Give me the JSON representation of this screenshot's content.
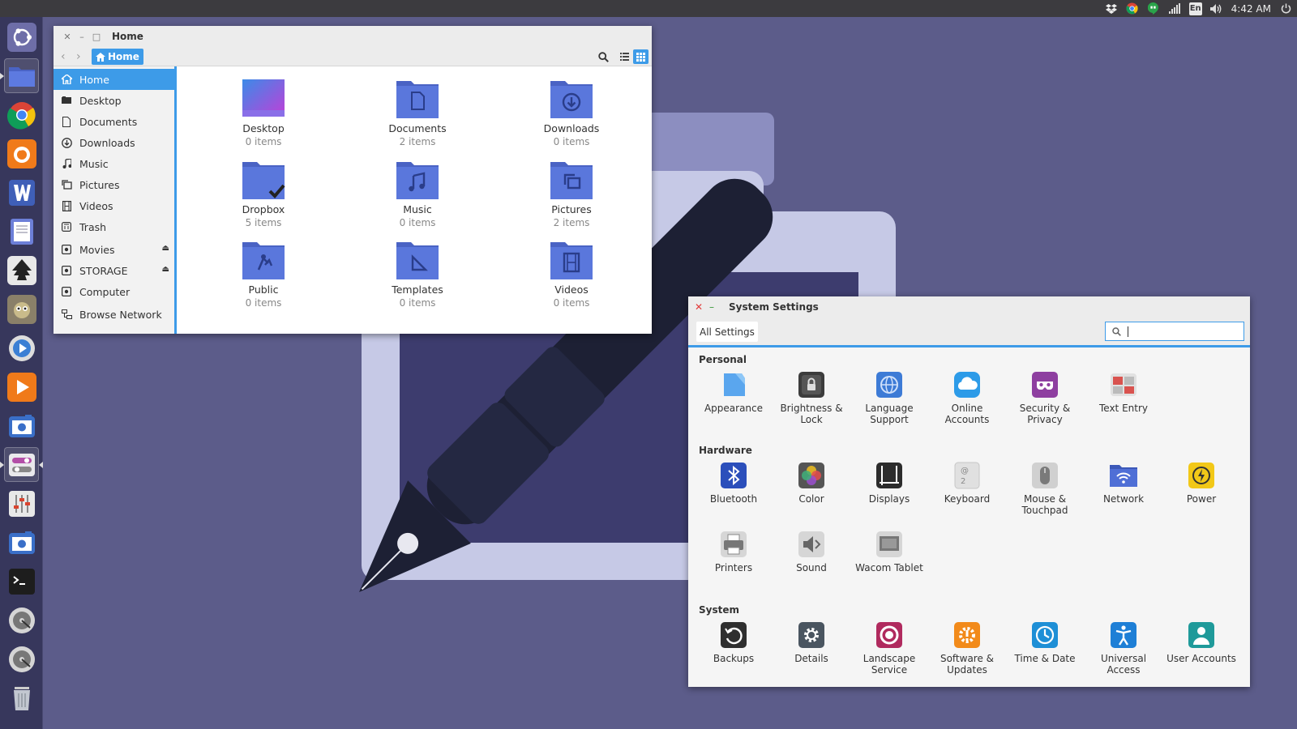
{
  "top_panel": {
    "time": "4:42 AM",
    "language": "En",
    "icons": [
      "dropbox-icon",
      "chrome-icon",
      "hangouts-icon",
      "signal-icon",
      "keyboard-language-icon",
      "volume-icon",
      "power-icon"
    ]
  },
  "launcher": {
    "items": [
      "dash-home-icon",
      "files-icon",
      "chrome-icon",
      "firefox-icon",
      "writer-icon",
      "text-editor-icon",
      "inkscape-icon",
      "gimp-icon",
      "video-player-icon",
      "media-player-icon",
      "camera-icon",
      "system-settings-icon",
      "mixer-icon",
      "screenshot-icon",
      "terminal-icon",
      "disk-icon",
      "disk-icon-2",
      "trash-icon"
    ]
  },
  "files": {
    "title": "Home",
    "breadcrumb": "Home",
    "sidebar": [
      {
        "label": "Home",
        "icon": "home-icon"
      },
      {
        "label": "Desktop",
        "icon": "desktop-icon"
      },
      {
        "label": "Documents",
        "icon": "document-icon"
      },
      {
        "label": "Downloads",
        "icon": "download-icon"
      },
      {
        "label": "Music",
        "icon": "music-icon"
      },
      {
        "label": "Pictures",
        "icon": "pictures-icon"
      },
      {
        "label": "Videos",
        "icon": "videos-icon"
      },
      {
        "label": "Trash",
        "icon": "trash-icon"
      },
      {
        "label": "Movies",
        "icon": "drive-icon"
      },
      {
        "label": "STORAGE",
        "icon": "drive-icon"
      },
      {
        "label": "Computer",
        "icon": "drive-icon"
      },
      {
        "label": "Browse Network",
        "icon": "network-icon"
      }
    ],
    "folders": [
      {
        "name": "Desktop",
        "count": "0 items"
      },
      {
        "name": "Documents",
        "count": "2 items"
      },
      {
        "name": "Downloads",
        "count": "0 items"
      },
      {
        "name": "Dropbox",
        "count": "5 items"
      },
      {
        "name": "Music",
        "count": "0 items"
      },
      {
        "name": "Pictures",
        "count": "2 items"
      },
      {
        "name": "Public",
        "count": "0 items"
      },
      {
        "name": "Templates",
        "count": "0 items"
      },
      {
        "name": "Videos",
        "count": "0 items"
      }
    ]
  },
  "settings": {
    "title": "System Settings",
    "all_settings": "All Settings",
    "search_value": "",
    "categories": {
      "personal": "Personal",
      "hardware": "Hardware",
      "system": "System"
    },
    "personal": [
      {
        "l1": "Appearance",
        "l2": "",
        "icon": "appearance-icon",
        "color": "#4a90d9"
      },
      {
        "l1": "Brightness &",
        "l2": "Lock",
        "icon": "lock-icon",
        "color": "#3c3c3c"
      },
      {
        "l1": "Language",
        "l2": "Support",
        "icon": "language-icon",
        "color": "#3d7bd6"
      },
      {
        "l1": "Online",
        "l2": "Accounts",
        "icon": "cloud-icon",
        "color": "#2d9be8"
      },
      {
        "l1": "Security &",
        "l2": "Privacy",
        "icon": "mask-icon",
        "color": "#8e3fa0"
      },
      {
        "l1": "Text Entry",
        "l2": "",
        "icon": "text-entry-icon",
        "color": "#d9d9d9"
      }
    ],
    "hardware": [
      {
        "l1": "Bluetooth",
        "l2": "",
        "icon": "bluetooth-icon",
        "color": "#2b4fbb"
      },
      {
        "l1": "Color",
        "l2": "",
        "icon": "color-icon",
        "color": "#555"
      },
      {
        "l1": "Displays",
        "l2": "",
        "icon": "displays-icon",
        "color": "#2c2c2c"
      },
      {
        "l1": "Keyboard",
        "l2": "",
        "icon": "keyboard-icon",
        "color": "#e0e0e0"
      },
      {
        "l1": "Mouse &",
        "l2": "Touchpad",
        "icon": "mouse-icon",
        "color": "#d0d0d0"
      },
      {
        "l1": "Network",
        "l2": "",
        "icon": "network-folder-icon",
        "color": "#3d6ed1"
      },
      {
        "l1": "Power",
        "l2": "",
        "icon": "power-icon",
        "color": "#f2c818"
      },
      {
        "l1": "Printers",
        "l2": "",
        "icon": "printer-icon",
        "color": "#d6d6d6"
      },
      {
        "l1": "Sound",
        "l2": "",
        "icon": "sound-icon",
        "color": "#d6d6d6"
      },
      {
        "l1": "Wacom Tablet",
        "l2": "",
        "icon": "tablet-icon",
        "color": "#d6d6d6"
      }
    ],
    "system": [
      {
        "l1": "Backups",
        "l2": "",
        "icon": "backup-icon",
        "color": "#2f2f2f"
      },
      {
        "l1": "Details",
        "l2": "",
        "icon": "gear-icon",
        "color": "#4a5560"
      },
      {
        "l1": "Landscape",
        "l2": "Service",
        "icon": "landscape-icon",
        "color": "#b02a5e"
      },
      {
        "l1": "Software &",
        "l2": "Updates",
        "icon": "software-icon",
        "color": "#f28a1a"
      },
      {
        "l1": "Time & Date",
        "l2": "",
        "icon": "clock-icon",
        "color": "#1e8fd6"
      },
      {
        "l1": "Universal",
        "l2": "Access",
        "icon": "accessibility-icon",
        "color": "#1e7fd6"
      },
      {
        "l1": "User Accounts",
        "l2": "",
        "icon": "user-icon",
        "color": "#1f9a9a"
      }
    ]
  }
}
